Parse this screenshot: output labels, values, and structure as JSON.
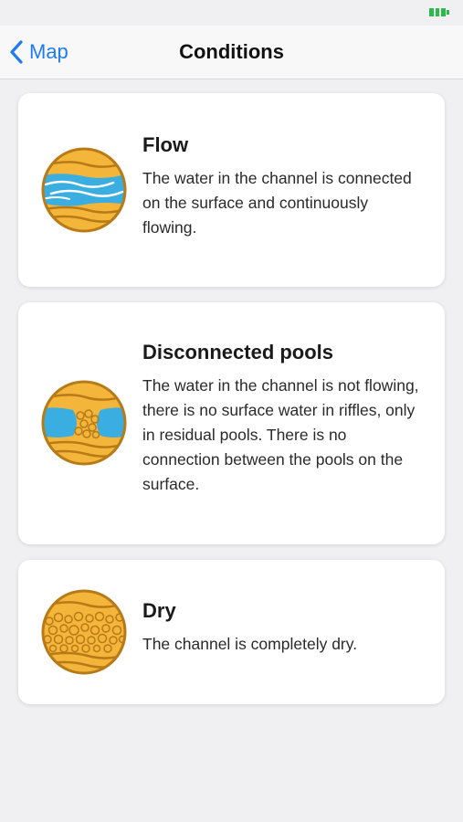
{
  "nav": {
    "back_label": "Map",
    "title": "Conditions"
  },
  "colors": {
    "accent": "#1e7cf2",
    "sand": "#f3b53a",
    "sand_outline": "#b77a17",
    "water": "#3aaee0"
  },
  "conditions": [
    {
      "title": "Flow",
      "description": "The water in the channel is connected on the surface and continuously flowing.",
      "icon": "flow-icon"
    },
    {
      "title": "Disconnected pools",
      "description": "The water in the channel is not flowing, there is no surface water in riffles, only in residual pools. There is no connection between the pools on the surface.",
      "icon": "disconnected-pools-icon"
    },
    {
      "title": "Dry",
      "description": "The channel is completely dry.",
      "icon": "dry-icon"
    }
  ]
}
